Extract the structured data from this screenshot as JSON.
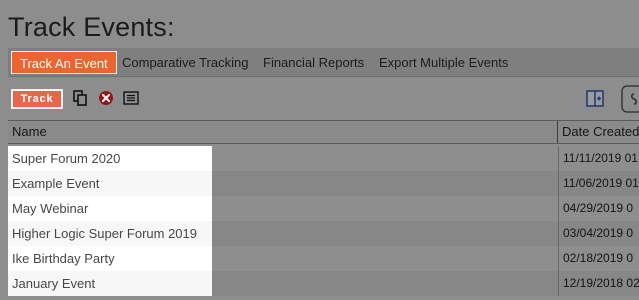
{
  "page": {
    "title": "Track Events:"
  },
  "tabs": [
    {
      "label": "Track An Event",
      "active": true
    },
    {
      "label": "Comparative Tracking",
      "active": false
    },
    {
      "label": "Financial Reports",
      "active": false
    },
    {
      "label": "Export Multiple Events",
      "active": false
    }
  ],
  "toolbar": {
    "track_label": "Track",
    "icons": [
      "copy-icon",
      "delete-icon",
      "list-icon",
      "columns-icon",
      "settings-icon"
    ]
  },
  "table": {
    "columns": [
      "Name",
      "Date Created"
    ],
    "rows": [
      {
        "name": "Super Forum 2020",
        "date": "11/11/2019 01:"
      },
      {
        "name": "Example Event",
        "date": "11/06/2019 01"
      },
      {
        "name": "May Webinar",
        "date": "04/29/2019 0"
      },
      {
        "name": "Higher Logic Super Forum 2019",
        "date": "03/04/2019 0"
      },
      {
        "name": "Ike Birthday Party",
        "date": "02/18/2019 0"
      },
      {
        "name": "January Event",
        "date": "12/19/2018 02"
      }
    ]
  },
  "colors": {
    "accent": "#e9672f",
    "track_button": "#e9664d",
    "overlay": "#8d8d8d"
  }
}
